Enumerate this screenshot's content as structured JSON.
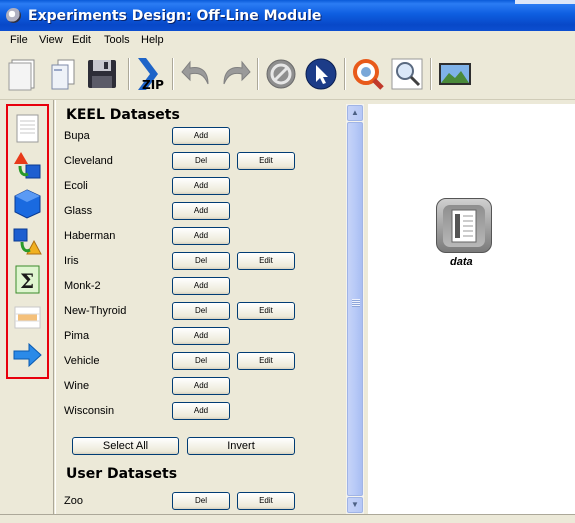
{
  "window": {
    "title": "Experiments Design: Off-Line Module"
  },
  "menu": [
    "File",
    "View",
    "Edit",
    "Tools",
    "Help"
  ],
  "toolbar": {
    "icons": [
      "new-document-icon",
      "open-document-icon",
      "save-icon",
      "zip-icon",
      "undo-icon",
      "redo-icon",
      "stop-icon",
      "pointer-icon",
      "help-icon",
      "zoom-icon",
      "image-icon"
    ],
    "zip_label": "ZIP"
  },
  "palette": {
    "icons": [
      "dataset-icon",
      "preprocess-icon",
      "method-icon",
      "postprocess-icon",
      "statistical-test-icon",
      "visualization-icon",
      "connection-arrow-icon"
    ],
    "sigma_label": "Σ"
  },
  "keel_datasets": {
    "title": "KEEL Datasets",
    "items": [
      {
        "name": "Bupa",
        "buttons": [
          "Add"
        ]
      },
      {
        "name": "Cleveland",
        "buttons": [
          "Del",
          "Edit"
        ]
      },
      {
        "name": "Ecoli",
        "buttons": [
          "Add"
        ]
      },
      {
        "name": "Glass",
        "buttons": [
          "Add"
        ]
      },
      {
        "name": "Haberman",
        "buttons": [
          "Add"
        ]
      },
      {
        "name": "Iris",
        "buttons": [
          "Del",
          "Edit"
        ]
      },
      {
        "name": "Monk-2",
        "buttons": [
          "Add"
        ]
      },
      {
        "name": "New-Thyroid",
        "buttons": [
          "Del",
          "Edit"
        ]
      },
      {
        "name": "Pima",
        "buttons": [
          "Add"
        ]
      },
      {
        "name": "Vehicle",
        "buttons": [
          "Del",
          "Edit"
        ]
      },
      {
        "name": "Wine",
        "buttons": [
          "Add"
        ]
      },
      {
        "name": "Wisconsin",
        "buttons": [
          "Add"
        ]
      }
    ],
    "select_all_label": "Select All",
    "invert_label": "Invert"
  },
  "user_datasets": {
    "title": "User Datasets",
    "items": [
      {
        "name": "Zoo",
        "buttons": [
          "Del",
          "Edit"
        ]
      }
    ]
  },
  "canvas": {
    "node_label": "data"
  },
  "colors": {
    "palette_border": "#e8000c",
    "title_bar": "#0a5ad8"
  }
}
